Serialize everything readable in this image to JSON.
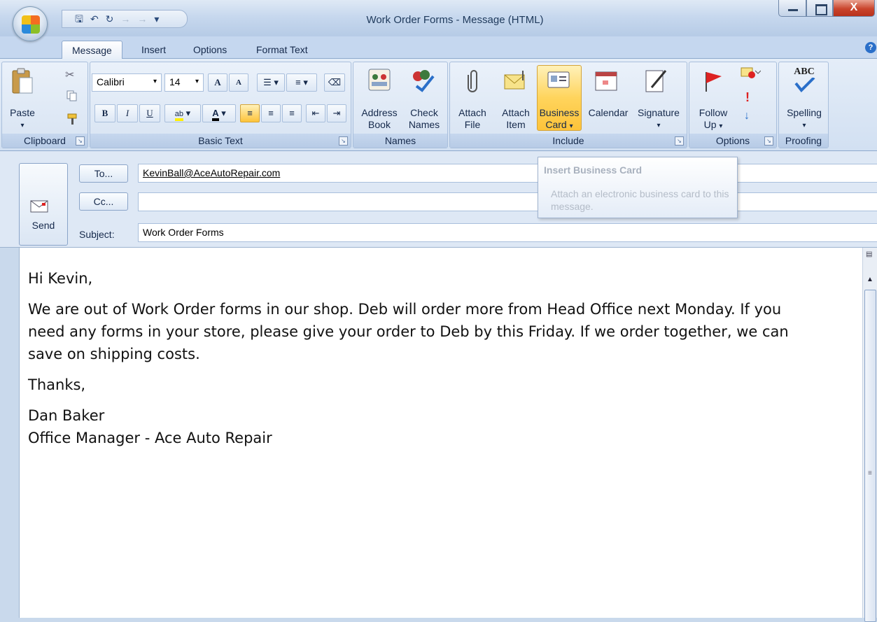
{
  "window": {
    "title": "Work Order Forms - Message (HTML)",
    "close_glyph": "X"
  },
  "qat": {
    "icons": [
      "save-icon",
      "undo-icon",
      "redo-icon",
      "up-arrow-icon",
      "down-arrow-icon",
      "customize-qat-icon"
    ]
  },
  "tabs": [
    "Message",
    "Insert",
    "Options",
    "Format Text"
  ],
  "ribbon": {
    "clipboard": {
      "label": "Clipboard",
      "paste": "Paste"
    },
    "basic_text": {
      "label": "Basic Text",
      "font": "Calibri",
      "size": "14",
      "bold": "B",
      "italic": "I",
      "underline": "U",
      "grow": "A",
      "shrink": "A"
    },
    "names": {
      "label": "Names",
      "address_book": [
        "Address",
        "Book"
      ],
      "check_names": [
        "Check",
        "Names"
      ]
    },
    "include": {
      "label": "Include",
      "attach_file": [
        "Attach",
        "File"
      ],
      "attach_item": [
        "Attach",
        "Item"
      ],
      "business_card": [
        "Business",
        "Card"
      ],
      "calendar": "Calendar",
      "signature": "Signature"
    },
    "options": {
      "label": "Options",
      "follow_up": [
        "Follow",
        "Up"
      ]
    },
    "proofing": {
      "label": "Proofing",
      "spelling": "Spelling",
      "abc": "ABC"
    }
  },
  "header": {
    "send": "Send",
    "to_button": "To...",
    "cc_button": "Cc...",
    "subject_label": "Subject:",
    "to_value": "KevinBall@AceAutoRepair.com",
    "cc_value": "",
    "subject_value": "Work Order Forms"
  },
  "tooltip": {
    "title": "Insert Business Card",
    "body": "Attach an electronic business card to this message."
  },
  "body": {
    "greeting": "Hi Kevin,",
    "paragraph_lines": [
      "We are out of Work Order forms in our shop. Deb will order more from Head Office next Monday.  If you",
      "need any forms in your store, please give your order to Deb by this Friday.  If we order together, we can",
      "save on shipping costs."
    ],
    "closing": "Thanks,",
    "signature_name": "Dan Baker",
    "signature_title": "Office Manager - Ace Auto Repair"
  },
  "colors": {
    "ribbon_bg": "#dbe6f4",
    "highlight": "#fdc33a",
    "title_text": "#1e395b"
  }
}
